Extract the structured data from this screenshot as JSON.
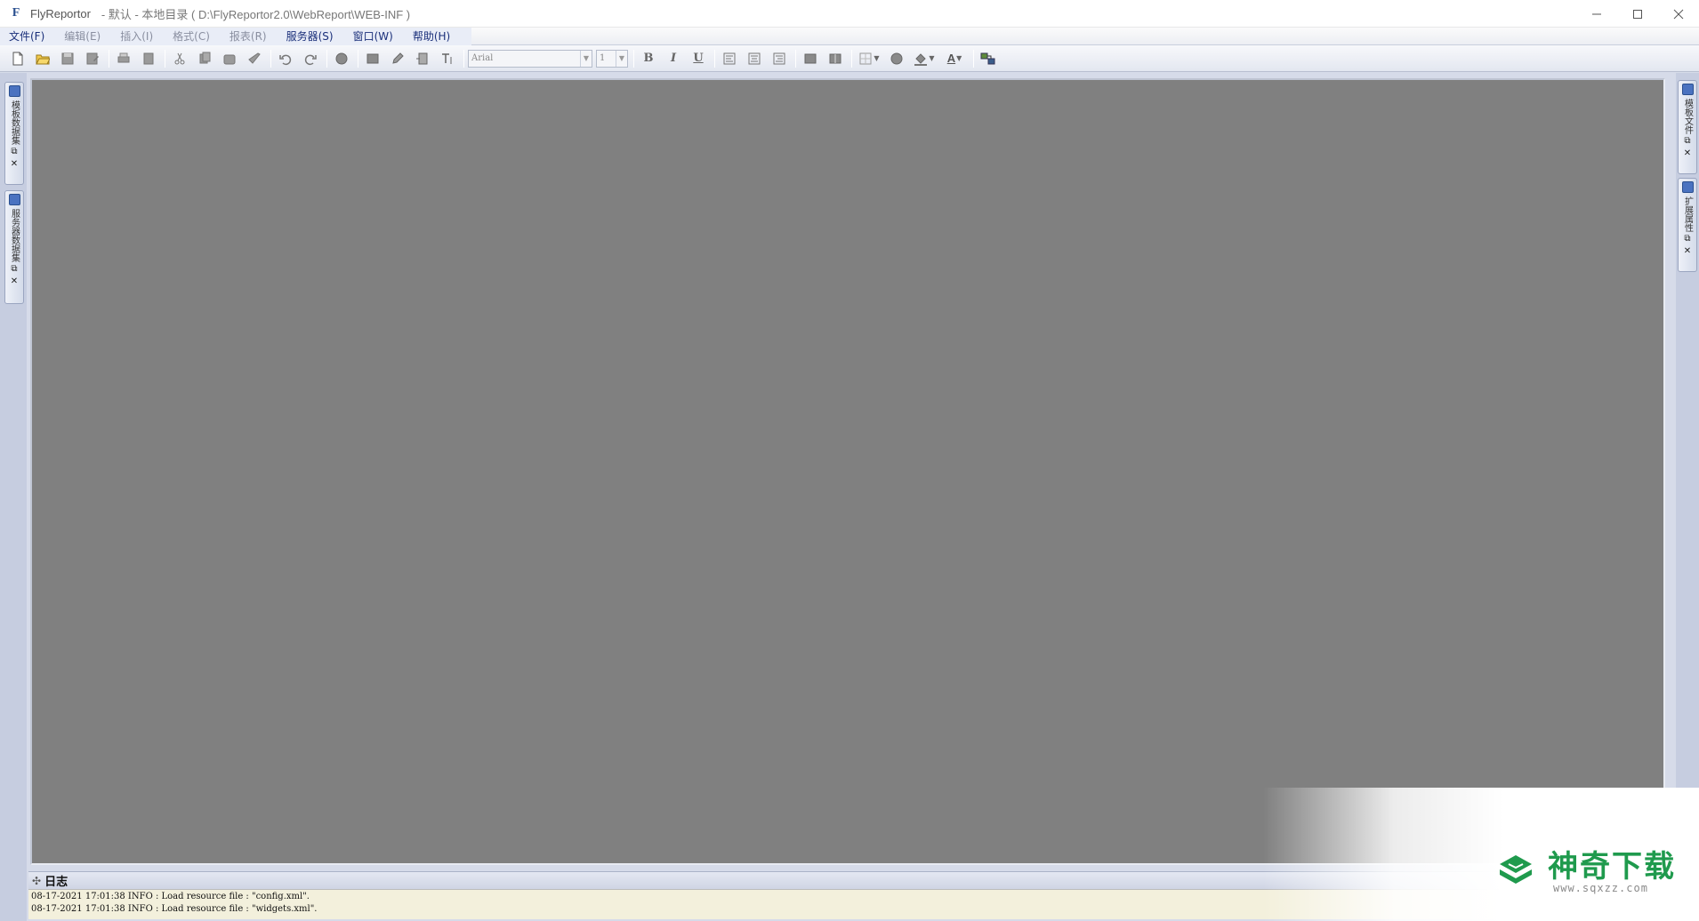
{
  "window": {
    "app_name": "FlyReportor",
    "path_title": "- 默认 - 本地目录 ( D:\\FlyReportor2.0\\WebReport\\WEB-INF )",
    "app_icon_glyph": "F"
  },
  "menu": [
    {
      "label": "文件(F)",
      "state": "active"
    },
    {
      "label": "编辑(E)",
      "state": "disabled"
    },
    {
      "label": "插入(I)",
      "state": "disabled"
    },
    {
      "label": "格式(C)",
      "state": "disabled"
    },
    {
      "label": "报表(R)",
      "state": "disabled"
    },
    {
      "label": "服务器(S)",
      "state": "active"
    },
    {
      "label": "窗口(W)",
      "state": "active"
    },
    {
      "label": "帮助(H)",
      "state": "active"
    }
  ],
  "toolbar": {
    "font_name": "Arial",
    "font_size": "1",
    "bold_label": "B",
    "italic_label": "I",
    "underline_label": "U",
    "font_color_label": "A"
  },
  "left_dock": [
    {
      "label": "模板数据集",
      "icon": "dataset-icon"
    },
    {
      "label": "服务器数据集",
      "icon": "server-dataset-icon"
    }
  ],
  "right_dock": [
    {
      "label": "模板文件",
      "icon": "template-file-icon"
    },
    {
      "label": "扩展属性",
      "icon": "extension-property-icon"
    }
  ],
  "log": {
    "title": "日志",
    "lines": [
      "08-17-2021 17:01:38 INFO : Load resource file : \"config.xml\".",
      "08-17-2021 17:01:38 INFO : Load resource file : \"widgets.xml\"."
    ]
  },
  "watermark": {
    "brand": "神奇下载",
    "url": "www.sqxzz.com",
    "color": "#1f9a4d"
  },
  "colors": {
    "workspace": "#808080",
    "chrome": "#d6dbe9",
    "log_bg": "#f3f0dc"
  }
}
